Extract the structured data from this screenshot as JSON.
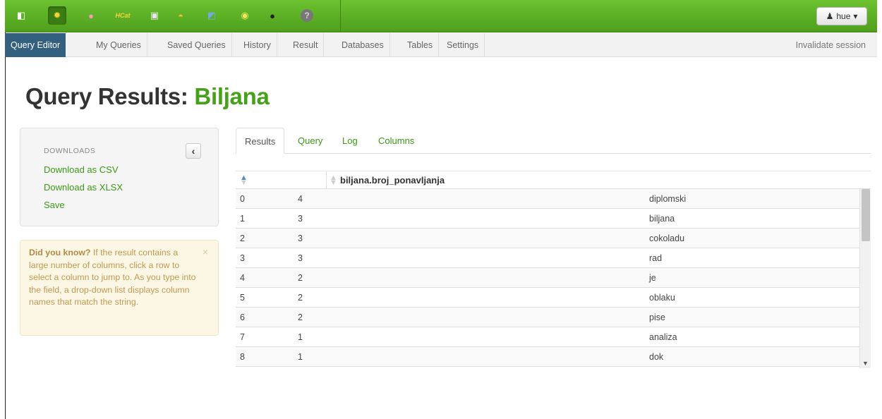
{
  "topbar": {
    "apps": [
      {
        "icon": "hue-home-icon",
        "glyph": "◧",
        "color": "#ffffff"
      },
      {
        "icon": "beeswax-query-icon",
        "glyph": "✹",
        "color": "#f6d43a"
      },
      {
        "icon": "pig-icon",
        "glyph": "●",
        "color": "#f49db3"
      },
      {
        "icon": "hcatalog-icon",
        "glyph": "HCat",
        "color": "#f6d43a"
      },
      {
        "icon": "file-browser-icon",
        "glyph": "▣",
        "color": "#e8e8e8"
      },
      {
        "icon": "job-designer-icon",
        "glyph": "◓",
        "color": "#f3c13a"
      },
      {
        "icon": "job-browser-icon",
        "glyph": "◩",
        "color": "#74a9e2"
      },
      {
        "icon": "oozie-icon",
        "glyph": "◉",
        "color": "#f2e85a"
      },
      {
        "icon": "user-admin-icon",
        "glyph": "●",
        "color": "#222222"
      },
      {
        "icon": "help-icon",
        "glyph": "?",
        "color": "#d6d6d6"
      }
    ],
    "user_label": "hue"
  },
  "subnav": {
    "items": [
      "Query Editor",
      "My Queries",
      "Saved Queries",
      "History",
      "Result",
      "Databases",
      "Tables",
      "Settings"
    ],
    "right_label": "Invalidate session"
  },
  "page": {
    "title_prefix": "Query Results:",
    "title_accent": "Biljana"
  },
  "downloads": {
    "header": "DOWNLOADS",
    "links": [
      "Download as CSV",
      "Download as XLSX",
      "Save"
    ]
  },
  "tip": {
    "bold": "Did you know?",
    "text": " If the result contains a large number of columns, click a row to select a column to jump to. As you type into the field, a drop-down list displays column names that match the string.",
    "close": "×"
  },
  "tabs": [
    "Results",
    "Query",
    "Log",
    "Columns"
  ],
  "table": {
    "column_header": "biljana.broj_ponavljanja",
    "rows": [
      [
        "0",
        "4",
        "diplomski"
      ],
      [
        "1",
        "3",
        "biljana"
      ],
      [
        "2",
        "3",
        "cokoladu"
      ],
      [
        "3",
        "3",
        "rad"
      ],
      [
        "4",
        "2",
        "je"
      ],
      [
        "5",
        "2",
        "oblaku"
      ],
      [
        "6",
        "2",
        "pise"
      ],
      [
        "7",
        "1",
        "analiza"
      ],
      [
        "8",
        "1",
        "dok"
      ]
    ]
  },
  "colors": {
    "brand_green": "#4f9f1c",
    "link_green": "#3a9a14",
    "nav_active": "#33607f"
  }
}
